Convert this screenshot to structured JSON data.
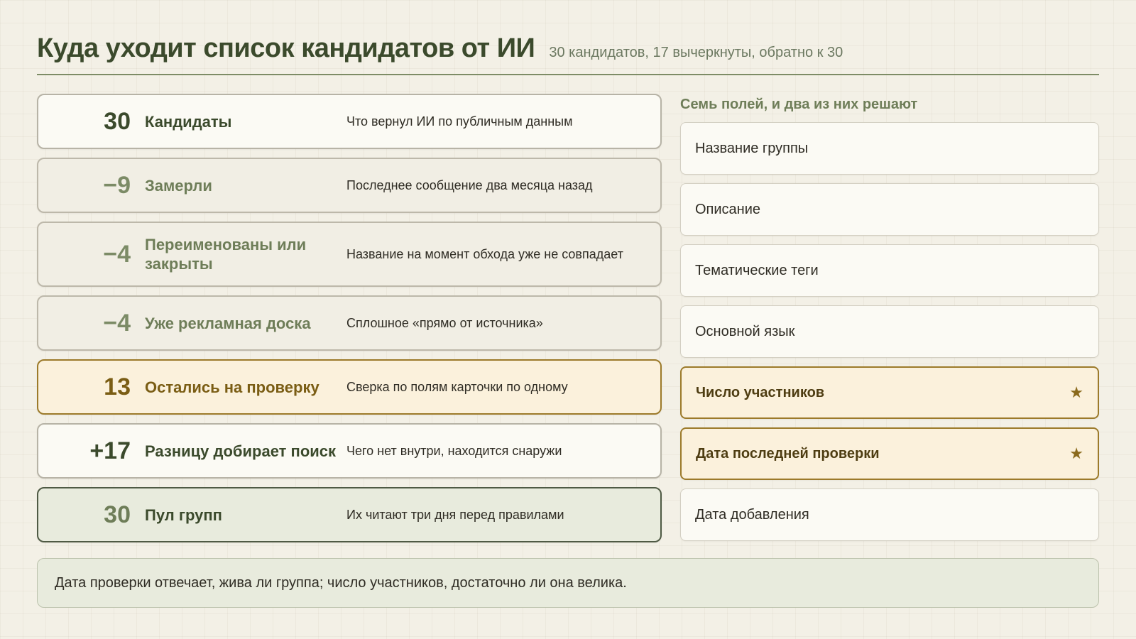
{
  "header": {
    "title": "Куда уходит список кандидатов от ИИ",
    "subtitle": "30 кандидатов, 17 вычеркнуты, обратно к 30"
  },
  "funnel": [
    {
      "value": "30",
      "label": "Кандидаты",
      "desc": "Что вернул ИИ по публичным данным",
      "style": "white"
    },
    {
      "value": "−9",
      "label": "Замерли",
      "desc": "Последнее сообщение два месяца назад",
      "style": "muted"
    },
    {
      "value": "−4",
      "label": "Переименованы или закрыты",
      "desc": "Название на момент обхода уже не совпадает",
      "style": "muted"
    },
    {
      "value": "−4",
      "label": "Уже рекламная доска",
      "desc": "Сплошное «прямо от источника»",
      "style": "muted"
    },
    {
      "value": "13",
      "label": "Остались на проверку",
      "desc": "Сверка по полям карточки по одному",
      "style": "highlight"
    },
    {
      "value": "+17",
      "label": "Разницу добирает поиск",
      "desc": "Чего нет внутри, находится снаружи",
      "style": "white"
    },
    {
      "value": "30",
      "label": "Пул групп",
      "desc": "Их читают три дня перед правилами",
      "style": "total"
    }
  ],
  "fields": {
    "heading": "Семь полей, и два из них решают",
    "items": [
      {
        "label": "Название группы",
        "key": false
      },
      {
        "label": "Описание",
        "key": false
      },
      {
        "label": "Тематические теги",
        "key": false
      },
      {
        "label": "Основной язык",
        "key": false
      },
      {
        "label": "Число участников",
        "key": true,
        "marker": "★"
      },
      {
        "label": "Дата последней проверки",
        "key": true,
        "marker": "★"
      },
      {
        "label": "Дата добавления",
        "key": false
      }
    ]
  },
  "note": "Дата проверки отвечает, жива ли группа; число участников, достаточно ли она велика."
}
